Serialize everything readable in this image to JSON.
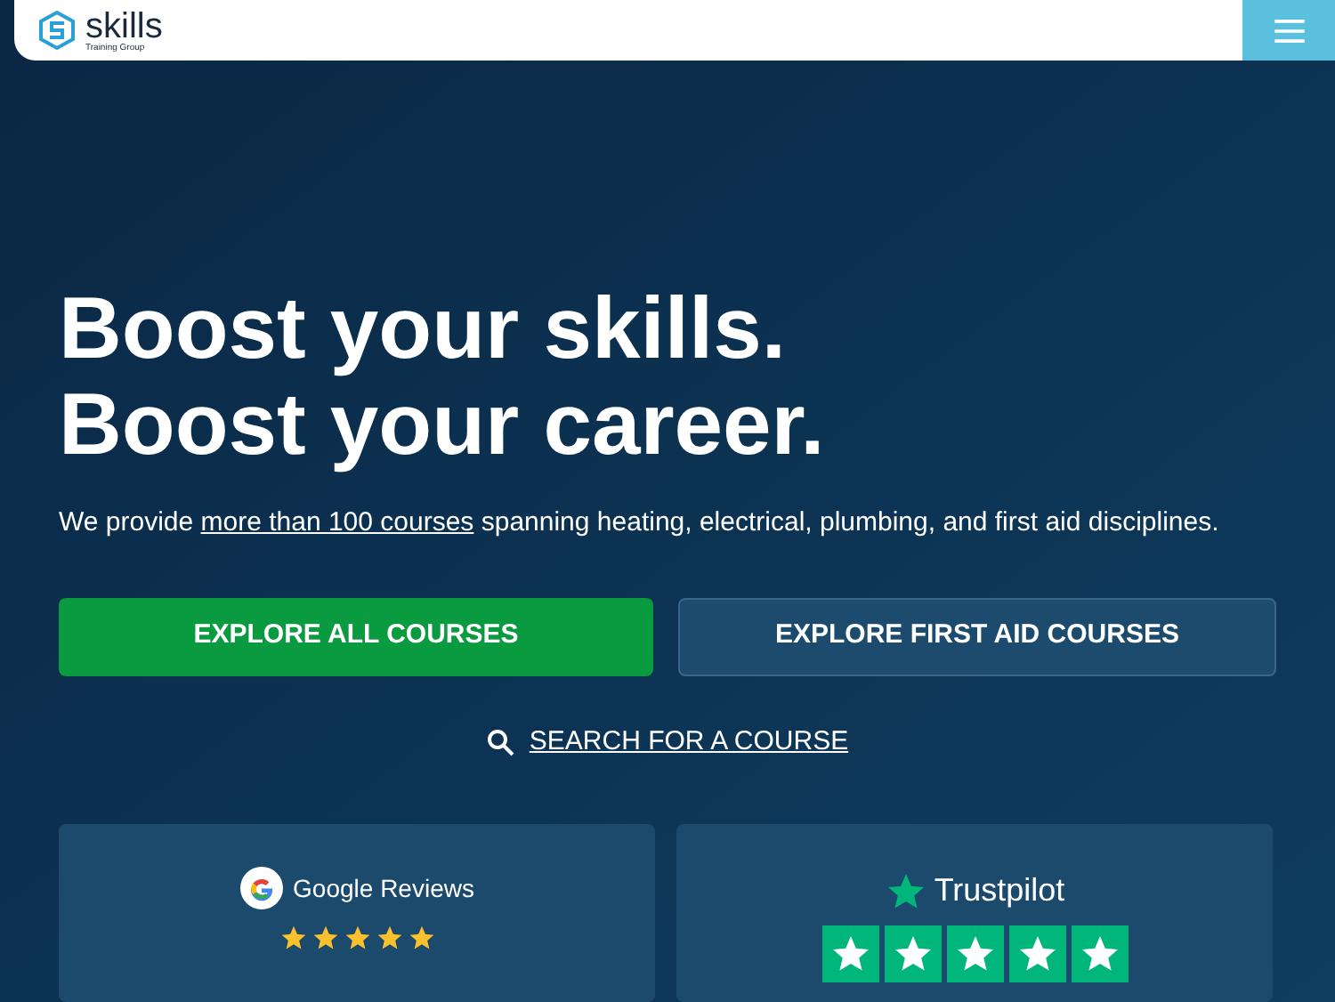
{
  "header": {
    "logo": {
      "name": "skills",
      "tagline": "Training Group"
    }
  },
  "hero": {
    "headline": [
      "Boost your skills.",
      "Boost your career."
    ],
    "intro": {
      "before": "We provide",
      "link": "more than 100 courses",
      "after": "spanning heating, electrical, plumbing, and first aid disciplines."
    },
    "buttons": [
      {
        "label": "EXPLORE ALL COURSES",
        "kind": "primary"
      },
      {
        "label": "EXPLORE FIRST AID COURSES",
        "kind": "secondary"
      }
    ],
    "search_link": "SEARCH FOR A COURSE"
  },
  "reviews": [
    {
      "kind": "google",
      "title": "Google Reviews",
      "stars": 5
    },
    {
      "kind": "trustpilot",
      "title": "Trustpilot",
      "stars": 5
    }
  ]
}
